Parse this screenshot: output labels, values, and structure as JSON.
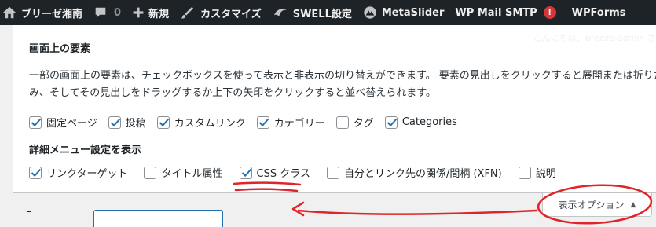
{
  "adminbar": {
    "site_name": "ブリーゼ湘南",
    "comments_count": "0",
    "new_label": "新規",
    "customize_label": "カスタマイズ",
    "swell_label": "SWELL設定",
    "metaslider_label": "MetaSlider",
    "wpmail_label": "WP Mail SMTP",
    "wpmail_badge": "!",
    "wpforms_label": "WPForms"
  },
  "panel": {
    "greeting": "こんにちは、breeze-admin さん",
    "title": "画面上の要素",
    "description": "一部の画面上の要素は、チェックボックスを使って表示と非表示の切り替えができます。 要素の見出しをクリックすると展開または折りたたみ、そしてその見出しをドラッグするか上下の矢印をクリックすると並べ替えられます。",
    "elements": [
      {
        "label": "固定ページ",
        "checked": true
      },
      {
        "label": "投稿",
        "checked": true
      },
      {
        "label": "カスタムリンク",
        "checked": true
      },
      {
        "label": "カテゴリー",
        "checked": true
      },
      {
        "label": "タグ",
        "checked": false
      },
      {
        "label": "Categories",
        "checked": true
      }
    ],
    "advanced_title": "詳細メニュー設定を表示",
    "advanced": [
      {
        "label": "リンクターゲット",
        "checked": true
      },
      {
        "label": "タイトル属性",
        "checked": false
      },
      {
        "label": "CSS クラス",
        "checked": true
      },
      {
        "label": "自分とリンク先の関係/間柄 (XFN)",
        "checked": false
      },
      {
        "label": "説明",
        "checked": false
      }
    ]
  },
  "screen_options_tab": {
    "label": "表示オプション",
    "arrow": "▲"
  },
  "colors": {
    "adminbar_bg": "#1d2327",
    "checkbox_accent": "#2271b1",
    "annotation_red": "#e0242a",
    "badge_red": "#d63638"
  },
  "icons": [
    "wordpress-logo-icon",
    "home-icon",
    "comment-icon",
    "plus-icon",
    "brush-icon",
    "swell-icon",
    "metaslider-icon"
  ]
}
